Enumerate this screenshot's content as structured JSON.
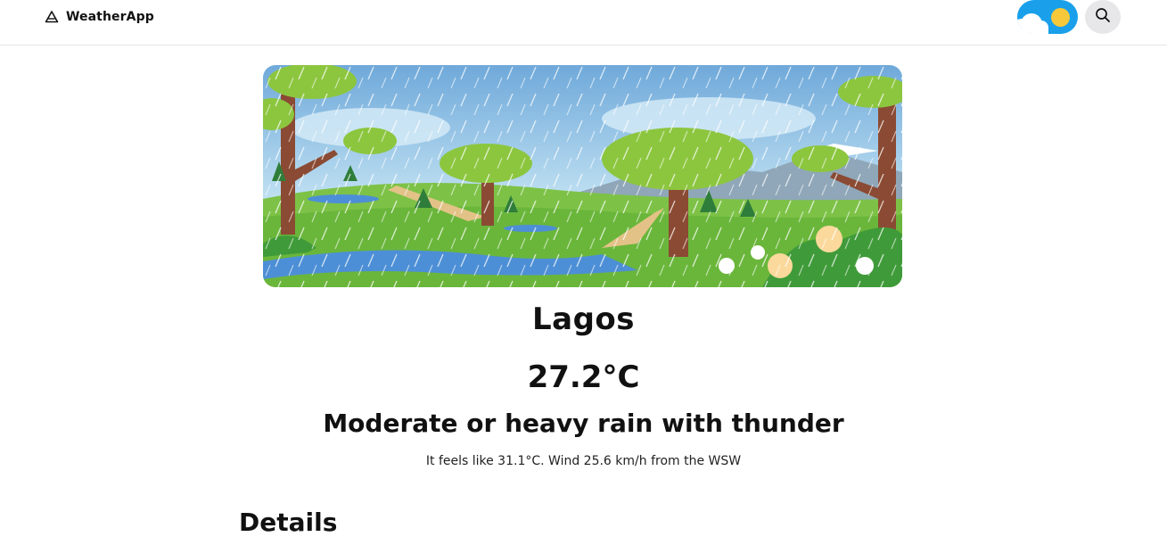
{
  "header": {
    "brand": "WeatherApp",
    "brand_icon": "triangle-logo-icon",
    "theme_toggle": {
      "icons": [
        "cloud-icon",
        "sun-icon"
      ],
      "colors": {
        "track": "#1aa0ea",
        "sun": "#f7c93a"
      }
    },
    "search_icon": "search-icon"
  },
  "hero": {
    "icon": "rainy-landscape-illustration"
  },
  "weather": {
    "city": "Lagos",
    "temperature": "27.2°C",
    "condition": "Moderate or heavy rain with thunder",
    "summary": "It feels like 31.1°C. Wind 25.6 km/h from the WSW"
  },
  "sections": {
    "details_title": "Details"
  }
}
